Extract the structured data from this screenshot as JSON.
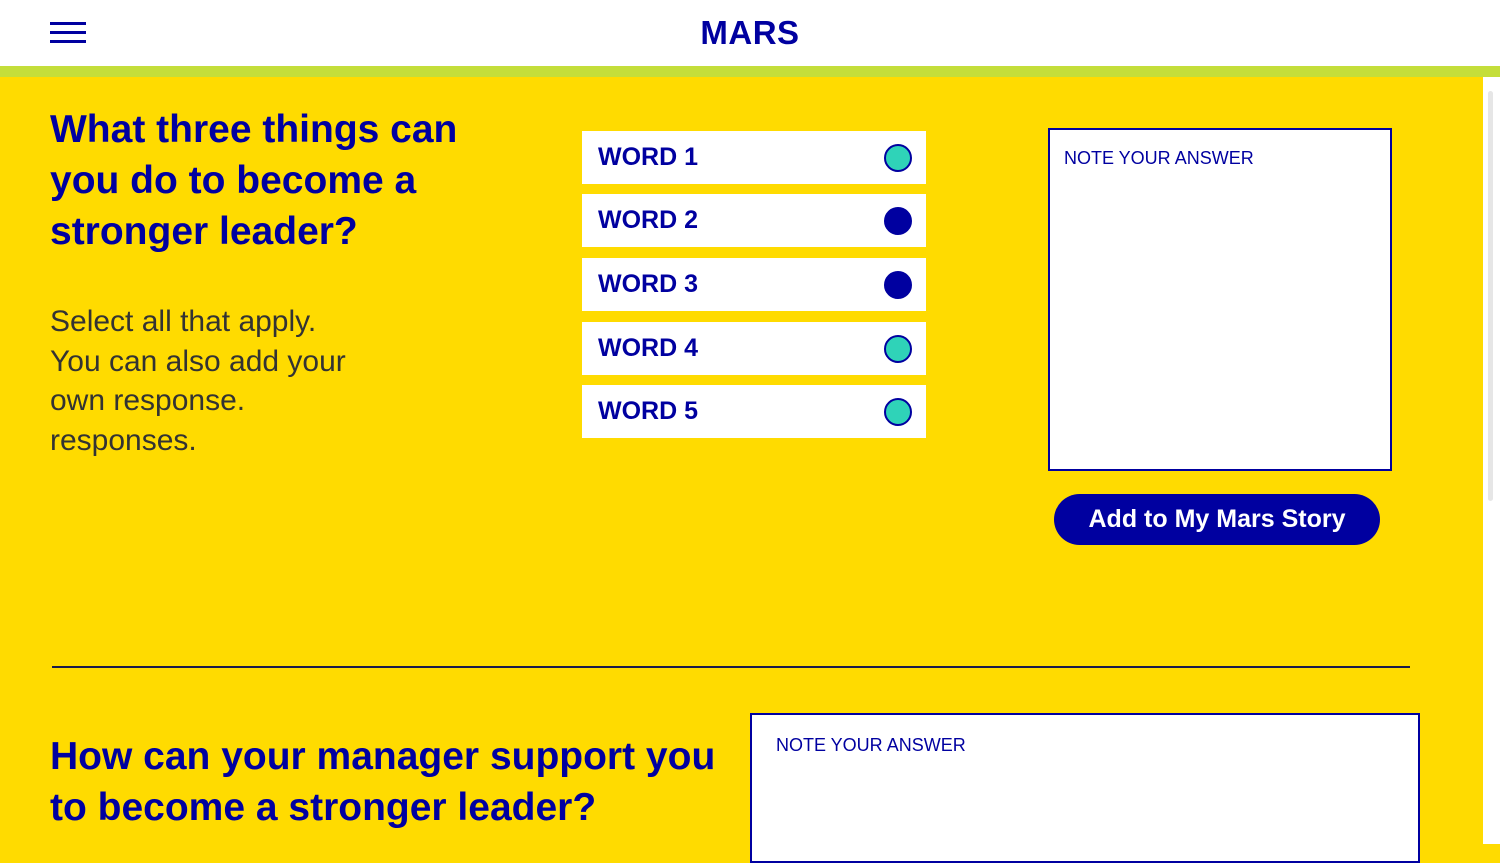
{
  "header": {
    "logo": "MARS",
    "menu_icon": "hamburger-menu-icon"
  },
  "colors": {
    "background": "#FFDB00",
    "brand_blue": "#0000A0",
    "accent_bar": "#C4DE3A",
    "radio_unselected": "#2FD3B8",
    "radio_selected": "#0000A0"
  },
  "question1": {
    "title": "What three things can you do to become a stronger leader?",
    "instructions": "Select all that apply. You can also add your own response. responses.",
    "options": [
      {
        "label": "WORD 1",
        "selected": false
      },
      {
        "label": "WORD 2",
        "selected": true
      },
      {
        "label": "WORD 3",
        "selected": true
      },
      {
        "label": "WORD 4",
        "selected": false
      },
      {
        "label": "WORD 5",
        "selected": false
      }
    ],
    "note_placeholder": "NOTE YOUR ANSWER",
    "note_value": "",
    "add_button_label": "Add to My Mars Story"
  },
  "question2": {
    "title": "How can your manager support you to become a stronger leader?",
    "note_placeholder": "NOTE YOUR ANSWER",
    "note_value": ""
  }
}
